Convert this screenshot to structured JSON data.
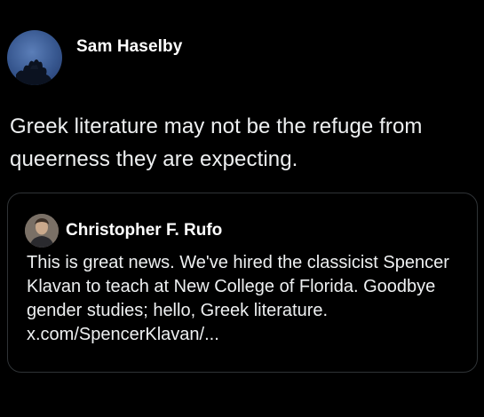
{
  "post": {
    "author_name": "Sam Haselby",
    "text": "Greek literature may not be the refuge from queerness they are expecting."
  },
  "quoted_post": {
    "author_name": "Christopher F. Rufo",
    "text": "This is great news. We've hired the classicist Spencer Klavan to teach at New College of Florida. Goodbye gender studies; hello, Greek literature. x.com/SpencerKlavan/..."
  },
  "colors": {
    "background": "#000000",
    "text": "#e7e9ea",
    "card_border": "#2f3336"
  }
}
